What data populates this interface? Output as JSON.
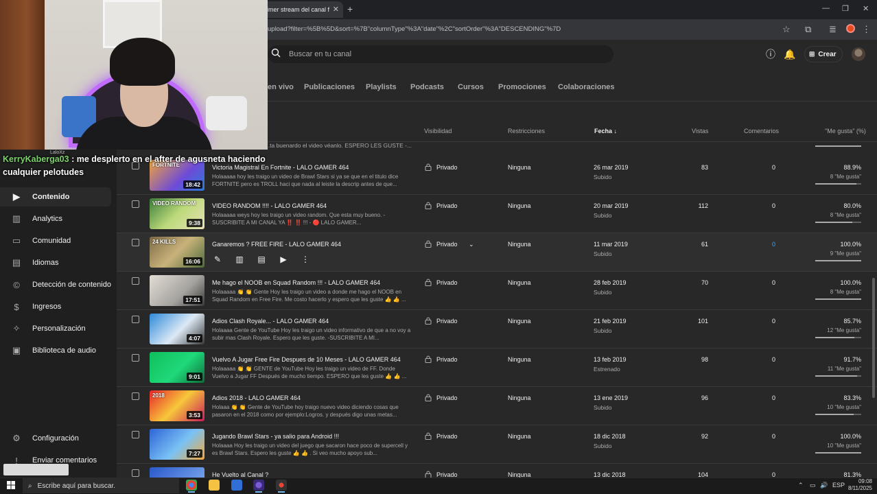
{
  "browser": {
    "tab_title": "rimer stream del canal f",
    "url": "upload?filter=%5B%5D&sort=%7B\"columnType\"%3A\"date\"%2C\"sortOrder\"%3A\"DESCENDING\"%7D"
  },
  "studio": {
    "search_placeholder": "Buscar en tu canal",
    "create_label": "Crear",
    "content_tabs": [
      "en vivo",
      "Publicaciones",
      "Playlists",
      "Podcasts",
      "Cursos",
      "Promociones",
      "Colaboraciones"
    ],
    "sidebar": {
      "items": [
        {
          "label": "Contenido",
          "icon": "content-icon"
        },
        {
          "label": "Analytics",
          "icon": "analytics-icon"
        },
        {
          "label": "Comunidad",
          "icon": "community-icon"
        },
        {
          "label": "Idiomas",
          "icon": "subtitles-icon"
        },
        {
          "label": "Detección de contenido",
          "icon": "copyright-icon"
        },
        {
          "label": "Ingresos",
          "icon": "dollar-icon"
        },
        {
          "label": "Personalización",
          "icon": "wand-icon"
        },
        {
          "label": "Biblioteca de audio",
          "icon": "audio-library-icon"
        }
      ],
      "bottom": [
        {
          "label": "Configuración",
          "icon": "gear-icon"
        },
        {
          "label": "Enviar comentarios",
          "icon": "feedback-icon"
        }
      ]
    },
    "columns": {
      "visibility": "Visibilidad",
      "restrictions": "Restricciones",
      "date": "Fecha",
      "views": "Vistas",
      "comments": "Comentarios",
      "likes": "\"Me gusta\" (%)"
    },
    "prev_row_desc": "...ta buenardo el video véanlo. ESPERO LES GUSTE -...",
    "rows": [
      {
        "title": "Victoria Magistral En Fortnite - LALO GAMER 464",
        "desc": "Holaaaaa hoy les traigo un video de Brawl Stars si ya se que en el titulo dice FORTNITE pero es TROLL haci que nada al leiste la descrip antes de que...",
        "duration": "18:42",
        "thumb_label": "FORTNITE",
        "visibility": "Privado",
        "restrictions": "Ninguna",
        "date": "26 mar 2019",
        "status": "Subido",
        "views": "83",
        "comments": "0",
        "likes_pct": "88.9%",
        "likes_sub": "8 \"Me gusta\"",
        "like_fraction": 0.889
      },
      {
        "title": "VIDEO RANDOM !!!! - LALO GAMER 464",
        "desc": "Holaaaaa weys hoy les traigo un video random. Que esta muy bueno. -SUSCRIBITE A MI CANAL YA ‼️ ‼️ !!! - 🔴 LALO GAMER...",
        "duration": "9:38",
        "thumb_label": "VIDEO RANDOM",
        "visibility": "Privado",
        "restrictions": "Ninguna",
        "date": "20 mar 2019",
        "status": "Subido",
        "views": "112",
        "comments": "0",
        "likes_pct": "80.0%",
        "likes_sub": "8 \"Me gusta\"",
        "like_fraction": 0.8
      },
      {
        "title": "Ganaremos ? FREE FIRE - LALO GAMER 464",
        "desc": "",
        "duration": "16:06",
        "thumb_label": "24 KILLS",
        "visibility": "Privado",
        "restrictions": "Ninguna",
        "date": "11 mar 2019",
        "status": "Subido",
        "views": "61",
        "comments": "0",
        "likes_pct": "100.0%",
        "likes_sub": "9 \"Me gusta\"",
        "like_fraction": 1.0
      },
      {
        "title": "Me hago el NOOB en Squad Random !!! - LALO GAMER 464",
        "desc": "Holaaaaa 👏 👏 Gente Hoy les traigo un video a donde me hago el NOOB en Squad Random en Free Fire. Me costo hacerlo y espero que les guste 👍 👍 ...",
        "duration": "17:51",
        "thumb_label": "",
        "visibility": "Privado",
        "restrictions": "Ninguna",
        "date": "28 feb 2019",
        "status": "Subido",
        "views": "70",
        "comments": "0",
        "likes_pct": "100.0%",
        "likes_sub": "8 \"Me gusta\"",
        "like_fraction": 1.0
      },
      {
        "title": "Adios Clash Royale... - LALO GAMER 464",
        "desc": "Holaaaa Gente de YouTube Hoy les traigo un video informativo de que a no voy a subir mas Clash Royale. Espero que les guste. -SUSCRIBITE A MI...",
        "duration": "4:07",
        "thumb_label": "",
        "visibility": "Privado",
        "restrictions": "Ninguna",
        "date": "21 feb 2019",
        "status": "Subido",
        "views": "101",
        "comments": "0",
        "likes_pct": "85.7%",
        "likes_sub": "12 \"Me gusta\"",
        "like_fraction": 0.857
      },
      {
        "title": "Vuelvo A Jugar Free Fire Despues de 10 Meses - LALO GAMER 464",
        "desc": "Holaaaaa 👏 👏 GENTE de YouTube Hoy les traigo un video de FF. Donde Vuelvo a Jugar FF Después de mucho tiempo. ESPERO que les guste 👍 👍 ...",
        "duration": "9:01",
        "thumb_label": "",
        "visibility": "Privado",
        "restrictions": "Ninguna",
        "date": "13 feb 2019",
        "status": "Estrenado",
        "views": "98",
        "comments": "0",
        "likes_pct": "91.7%",
        "likes_sub": "11 \"Me gusta\"",
        "like_fraction": 0.917
      },
      {
        "title": "Adios 2018 - LALO GAMER 464",
        "desc": "Holaaa 👏 👏 Gente de YouTube hoy traigo nuevo video diciendo cosas que pasaron en el 2018 como por ejemplo:Logros. y después digo unas metas...",
        "duration": "3:53",
        "thumb_label": "2018",
        "visibility": "Privado",
        "restrictions": "Ninguna",
        "date": "13 ene 2019",
        "status": "Subido",
        "views": "96",
        "comments": "0",
        "likes_pct": "83.3%",
        "likes_sub": "10 \"Me gusta\"",
        "like_fraction": 0.833
      },
      {
        "title": "Jugando Brawl Stars - ya salio para Android !!!",
        "desc": "Holaaaa Hoy les traigo un video del juego que sacaron hace poco de supercell y es Brawl Stars. Espero les guste 👍 👍 . Si veo mucho apoyo sub...",
        "duration": "7:27",
        "thumb_label": "",
        "visibility": "Privado",
        "restrictions": "Ninguna",
        "date": "18 dic 2018",
        "status": "Subido",
        "views": "92",
        "comments": "0",
        "likes_pct": "100.0%",
        "likes_sub": "10 \"Me gusta\"",
        "like_fraction": 1.0
      },
      {
        "title": "He Vuelto al Canal ?",
        "desc": "",
        "duration": "",
        "thumb_label": "",
        "visibility": "Privado",
        "restrictions": "Ninguna",
        "date": "13 dic 2018",
        "status": "",
        "views": "104",
        "comments": "0",
        "likes_pct": "81.3%",
        "likes_sub": "",
        "like_fraction": 0.813
      }
    ]
  },
  "overlay": {
    "chat_user": "KerryKaberga03",
    "chat_sep": " : ",
    "chat_message": "me desplerto en el after de agusneta haciendo cualquier pelotudes",
    "small_label": "LaloXz"
  },
  "taskbar": {
    "search_placeholder": "Escribe aquí para buscar.",
    "lang": "ESP",
    "time": "09:08",
    "date": "8/11/2025"
  },
  "colors": {
    "accent_link": "#3ea6ff",
    "chat_user": "#7cd36b",
    "headboard_glow": "#c26bff"
  }
}
